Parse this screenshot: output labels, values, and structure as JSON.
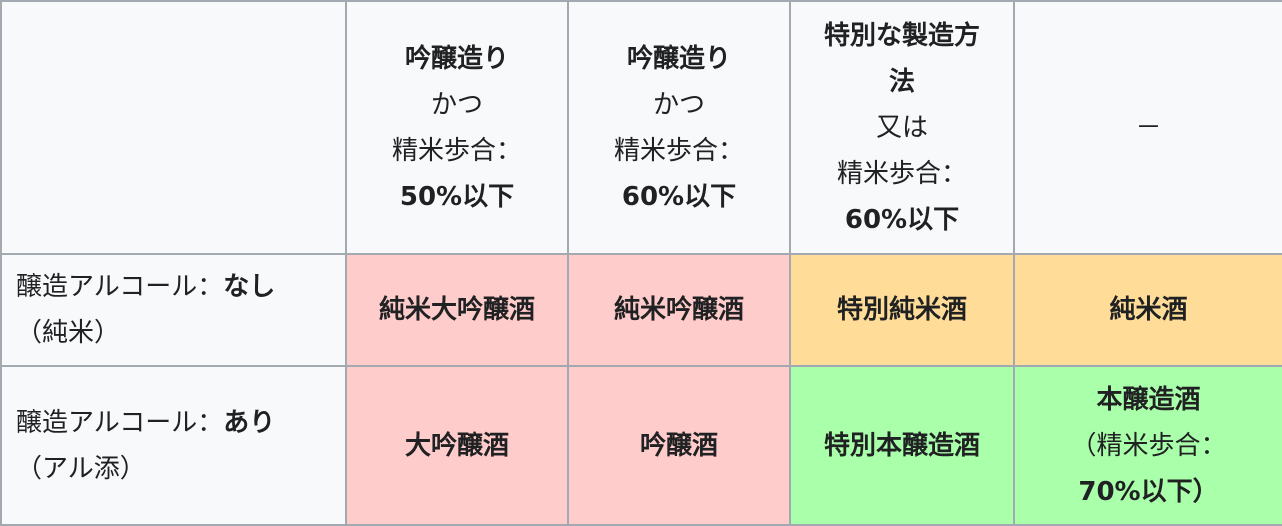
{
  "header": {
    "col1": {
      "l1": "吟醸造り",
      "l2": "かつ",
      "l3": "精米歩合：",
      "l4": "50%以下"
    },
    "col2": {
      "l1": "吟醸造り",
      "l2": "かつ",
      "l3": "精米歩合：",
      "l4": "60%以下"
    },
    "col3": {
      "l1a": "特別な製造方",
      "l1b": "法",
      "l2": "又は",
      "l3": "精米歩合：",
      "l4": "60%以下"
    },
    "col4": {
      "l1": "－"
    }
  },
  "row1": {
    "head": {
      "prefix": "醸造アルコール：",
      "strong": "なし",
      "suffix": "（純米）"
    },
    "cells": [
      "純米大吟醸酒",
      "純米吟醸酒",
      "特別純米酒",
      "純米酒"
    ]
  },
  "row2": {
    "head": {
      "prefix": "醸造アルコール：",
      "strong": "あり",
      "suffix": "（アル添）"
    },
    "cells": [
      "大吟醸酒",
      "吟醸酒",
      "特別本醸造酒"
    ],
    "last": {
      "l1": "本醸造酒",
      "l2": "（精米歩合：",
      "l3": "70%以下）"
    }
  },
  "colors": {
    "pink": "#ffcccc",
    "orange": "#ffdd99",
    "green": "#aaffaa",
    "header_bg": "#f8f9fa",
    "border": "#a2a9b1"
  }
}
